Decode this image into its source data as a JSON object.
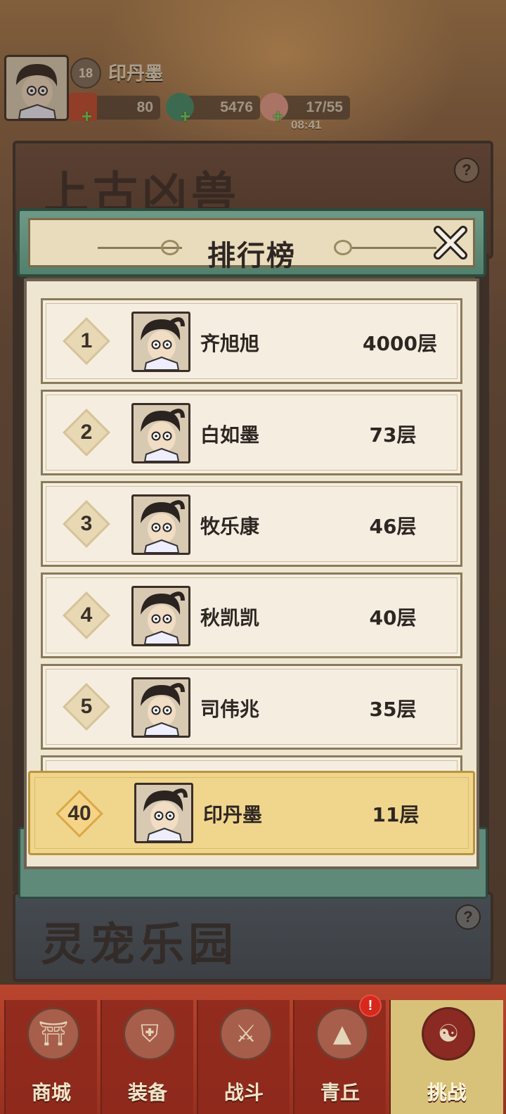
{
  "player": {
    "level": "18",
    "name": "印丹墨",
    "resources": [
      {
        "name": "scroll",
        "value": "80"
      },
      {
        "name": "jade-dragon",
        "value": "5476"
      },
      {
        "name": "peach",
        "value": "17/55"
      }
    ],
    "timer": "08:41"
  },
  "background": {
    "banner_top_title": "上古凶兽",
    "banner_bottom_title": "灵宠乐园"
  },
  "modal": {
    "title": "排行榜",
    "close_label": "✕"
  },
  "leaderboard": [
    {
      "rank": "1",
      "name": "齐旭旭",
      "score": "4000层"
    },
    {
      "rank": "2",
      "name": "白如墨",
      "score": "73层"
    },
    {
      "rank": "3",
      "name": "牧乐康",
      "score": "46层"
    },
    {
      "rank": "4",
      "name": "秋凯凯",
      "score": "40层"
    },
    {
      "rank": "5",
      "name": "司伟兆",
      "score": "35层"
    }
  ],
  "self_entry": {
    "rank": "40",
    "name": "印丹墨",
    "score": "11层"
  },
  "bottom_nav": [
    {
      "label": "商城",
      "icon": "shop-icon"
    },
    {
      "label": "装备",
      "icon": "armor-icon"
    },
    {
      "label": "战斗",
      "icon": "crossed-swords-icon"
    },
    {
      "label": "青丘",
      "icon": "mountain-icon",
      "badge": "!"
    },
    {
      "label": "挑战",
      "icon": "challenge-icon",
      "active": true
    }
  ],
  "colors": {
    "modal_header": "#5f8a7a",
    "paper": "#efe6d2",
    "self_highlight": "#f0d68c",
    "nav_red": "#b9452e"
  }
}
